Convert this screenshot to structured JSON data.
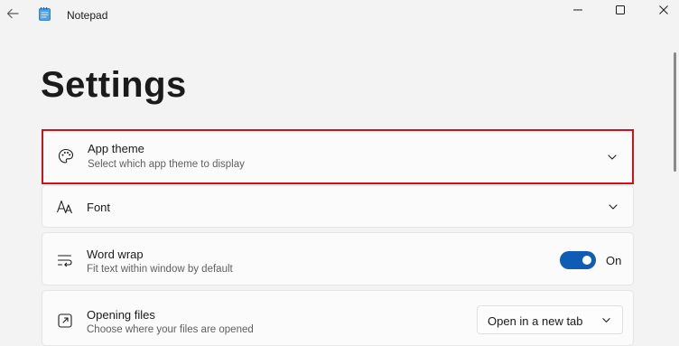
{
  "window": {
    "app_title": "Notepad",
    "back_icon": "back-arrow-icon",
    "app_icon": "notepad-icon",
    "controls": [
      "minimize-icon",
      "maximize-icon",
      "close-icon"
    ]
  },
  "page": {
    "title": "Settings"
  },
  "settings": {
    "app_theme": {
      "title": "App theme",
      "subtitle": "Select which app theme to display",
      "icon": "palette-icon",
      "highlighted": true,
      "highlight_color": "#d0111b"
    },
    "font": {
      "title": "Font",
      "icon": "font-size-icon"
    },
    "word_wrap": {
      "title": "Word wrap",
      "subtitle": "Fit text within window by default",
      "icon": "word-wrap-icon",
      "toggle_state": "On",
      "toggle_color": "#0f5cb4"
    },
    "opening_files": {
      "title": "Opening files",
      "subtitle": "Choose where your files are opened",
      "icon": "open-external-icon",
      "selected": "Open in a new tab"
    }
  }
}
